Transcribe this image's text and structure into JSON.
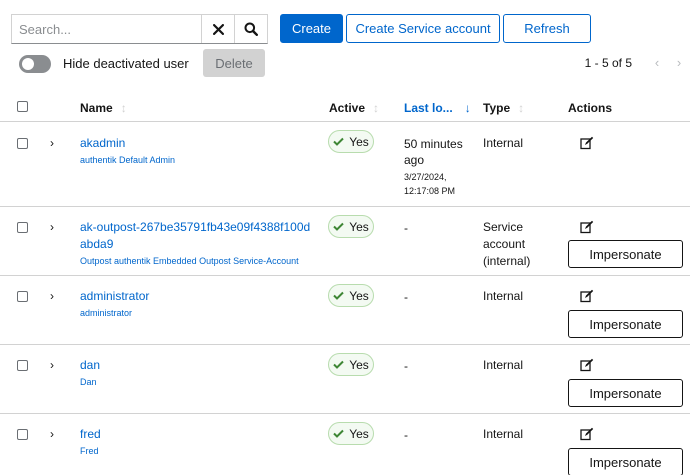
{
  "toolbar": {
    "search_placeholder": "Search...",
    "create_label": "Create",
    "create_service_account_label": "Create Service account",
    "refresh_label": "Refresh",
    "hide_deactivated_label": "Hide deactivated user",
    "hide_deactivated_on": false,
    "delete_label": "Delete"
  },
  "pagination": {
    "range_text": "1 - 5 of 5"
  },
  "table": {
    "headers": {
      "name": "Name",
      "active": "Active",
      "last_login": "Last lo...",
      "type": "Type",
      "actions": "Actions"
    },
    "rows": [
      {
        "username": "akadmin",
        "display_name": "authentik Default Admin",
        "active": "Yes",
        "last_login_relative": "50 minutes ago",
        "last_login_date": "3/27/2024, 12:17:08 PM",
        "type": "Internal",
        "impersonate": ""
      },
      {
        "username": "ak-outpost-267be35791fb43e09f4388f100dabda9",
        "display_name": "Outpost authentik Embedded Outpost Service-Account",
        "active": "Yes",
        "last_login_relative": "-",
        "last_login_date": "",
        "type": "Service account (internal)",
        "impersonate": "Impersonate"
      },
      {
        "username": "administrator",
        "display_name": "administrator",
        "active": "Yes",
        "last_login_relative": "-",
        "last_login_date": "",
        "type": "Internal",
        "impersonate": "Impersonate"
      },
      {
        "username": "dan",
        "display_name": "Dan",
        "active": "Yes",
        "last_login_relative": "-",
        "last_login_date": "",
        "type": "Internal",
        "impersonate": "Impersonate"
      },
      {
        "username": "fred",
        "display_name": "Fred",
        "active": "Yes",
        "last_login_relative": "-",
        "last_login_date": "",
        "type": "Internal",
        "impersonate": "Impersonate"
      }
    ]
  },
  "colors": {
    "primary": "#0066cc",
    "success_border": "#b8dcae",
    "success_check": "#3e8635"
  }
}
